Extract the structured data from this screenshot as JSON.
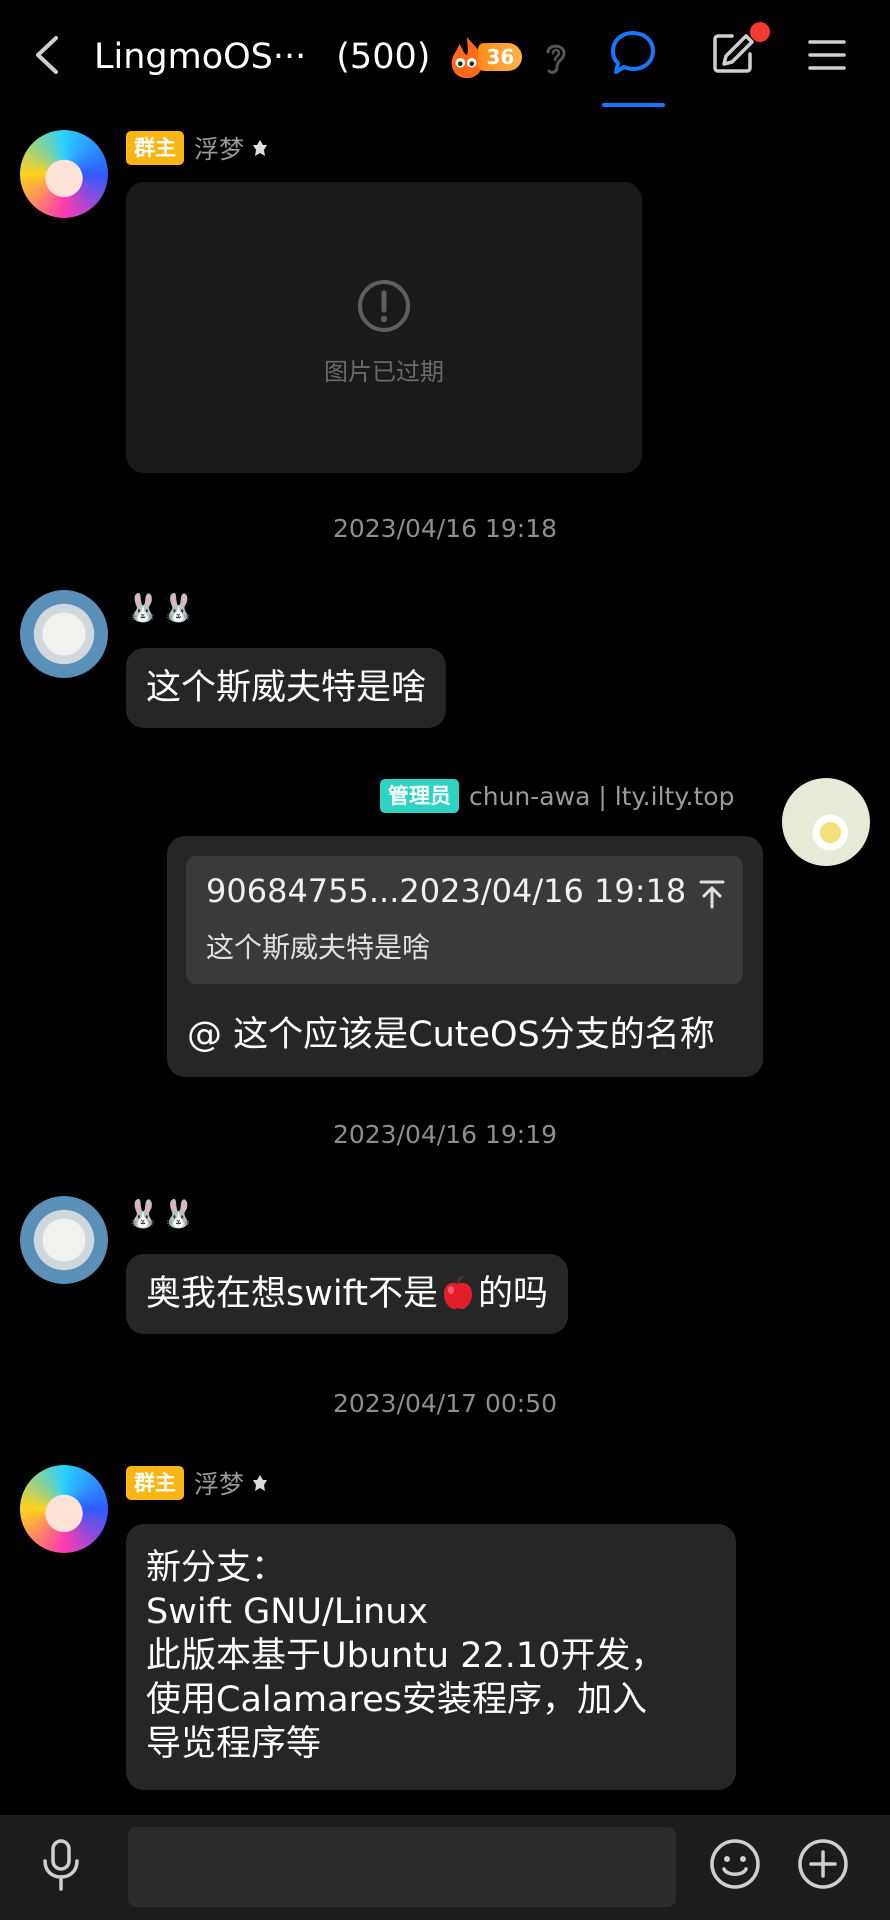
{
  "header": {
    "title": "LingmoOS···",
    "member_count": "(500)",
    "fire_level": "36",
    "colors": {
      "active_tab": "#1677ff",
      "notify_dot": "#f23a2f"
    }
  },
  "messages": {
    "m1": {
      "role": "群主",
      "name": "浮梦",
      "expired_text": "图片已过期"
    },
    "t1": "2023/04/16 19:18",
    "m2": {
      "name": "🐰🐰",
      "text": "这个斯威夫特是啥"
    },
    "m3": {
      "role": "管理员",
      "name": "chun-awa | lty.ilty.top",
      "quote_meta": "90684755...2023/04/16 19:18",
      "quote_text": "这个斯威夫特是啥",
      "text": "@ 这个应该是CuteOS分支的名称"
    },
    "t2": "2023/04/16 19:19",
    "m4": {
      "name": "🐰🐰",
      "text_before": "奥我在想swift不是",
      "text_after": "的吗"
    },
    "t3": "2023/04/17 00:50",
    "m5": {
      "role": "群主",
      "name": "浮梦",
      "lines": [
        "新分支：",
        "Swift GNU/Linux",
        "此版本基于Ubuntu 22.10开发，",
        "使用Calamares安装程序，加入",
        "导览程序等"
      ]
    }
  },
  "input": {
    "value": "",
    "placeholder": ""
  },
  "icons": [
    "back-icon",
    "fire-icon",
    "ear-icon",
    "chat-bubble-icon",
    "edit-icon",
    "menu-icon",
    "mic-icon",
    "emoji-icon",
    "plus-icon",
    "warning-icon",
    "jump-up-icon",
    "apple-emoji-icon"
  ],
  "tag_colors": {
    "owner": "#f8b514",
    "admin": "#2fd3c4"
  }
}
